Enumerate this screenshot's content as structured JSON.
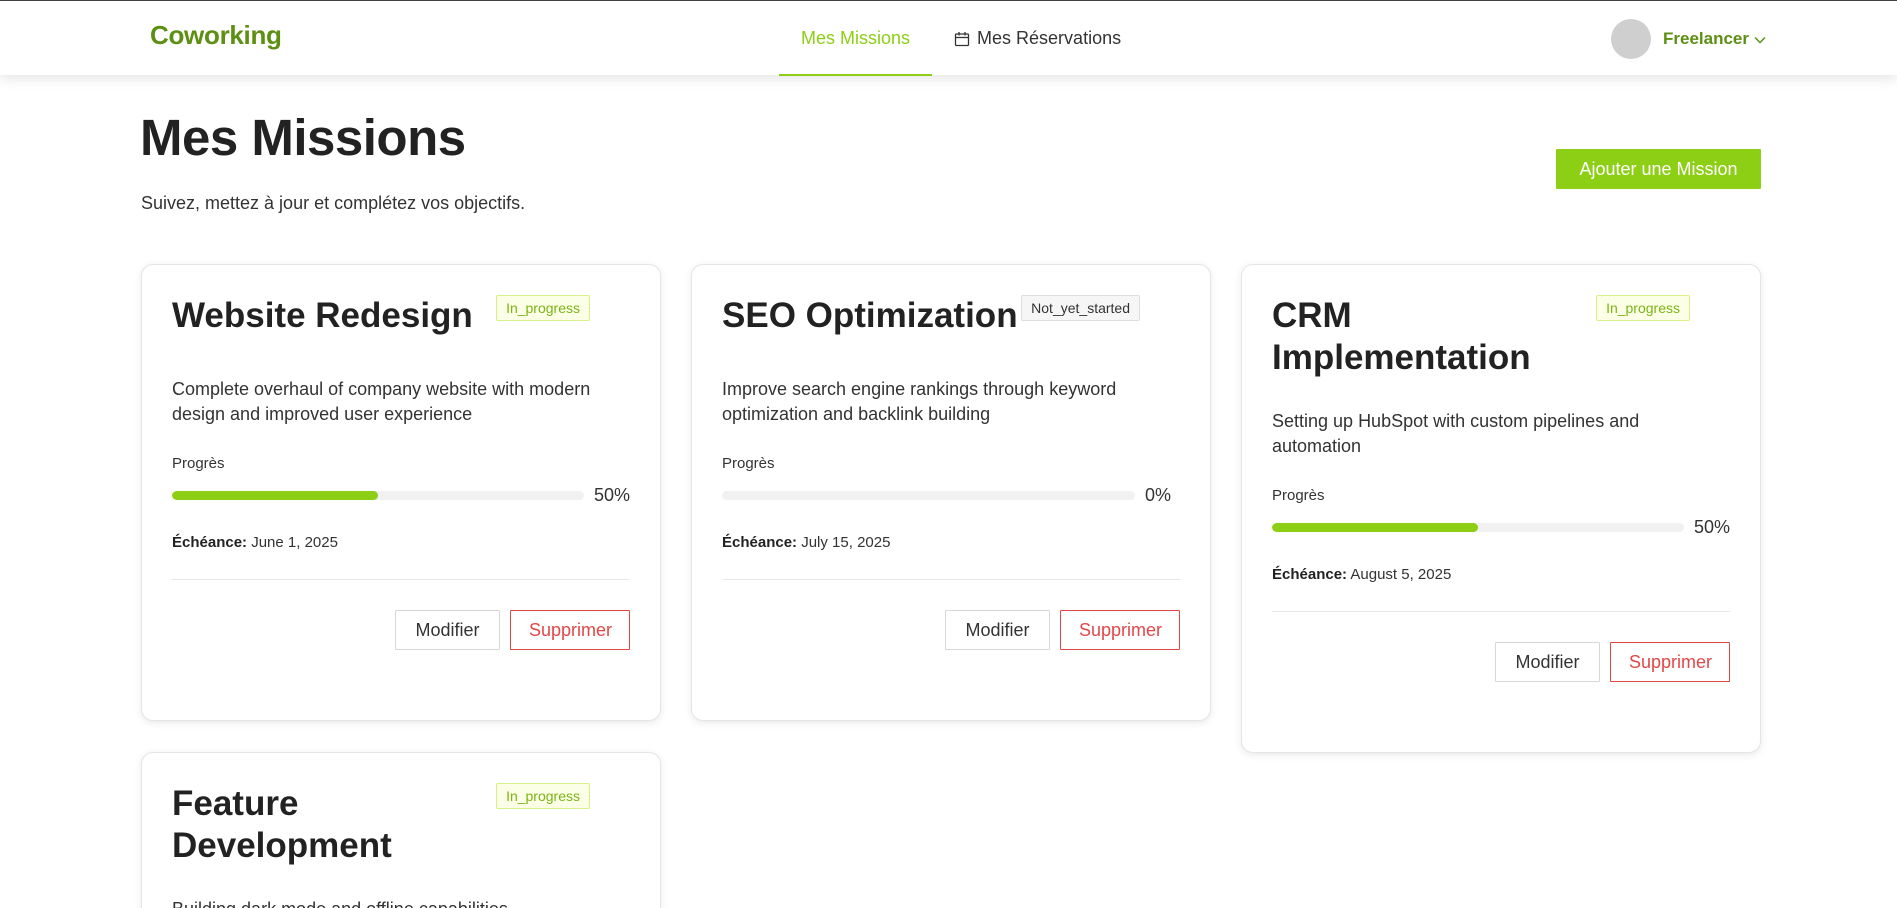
{
  "brand": "Coworking",
  "nav": {
    "missions": "Mes Missions",
    "reservations": "Mes Réservations"
  },
  "user": {
    "name": "Freelancer"
  },
  "page": {
    "title": "Mes Missions",
    "subtitle": "Suivez, mettez à jour et complétez vos objectifs.",
    "add_button": "Ajouter une Mission"
  },
  "labels": {
    "progress": "Progrès",
    "due": "Échéance:",
    "edit": "Modifier",
    "delete": "Supprimer"
  },
  "colors": {
    "accent": "#8ccf14",
    "brand": "#5c8f12",
    "danger": "#e04848"
  },
  "missions": [
    {
      "title": "Website Redesign",
      "status": "In_progress",
      "description": "Complete overhaul of company website with modern design and improved user experience",
      "progress": 50,
      "progress_text": "50%",
      "due": "June 1, 2025"
    },
    {
      "title": "SEO Optimization",
      "status": "Not_yet_started",
      "description": "Improve search engine rankings through keyword optimization and backlink building",
      "progress": 0,
      "progress_text": "0%",
      "due": "July 15, 2025"
    },
    {
      "title": "CRM Implementation",
      "status": "In_progress",
      "description": "Setting up HubSpot with custom pipelines and automation",
      "progress": 50,
      "progress_text": "50%",
      "due": "August 5, 2025"
    },
    {
      "title": "Feature Development",
      "status": "In_progress",
      "description": "Building dark mode and offline capabilities",
      "progress": null,
      "progress_text": "",
      "due": ""
    }
  ]
}
